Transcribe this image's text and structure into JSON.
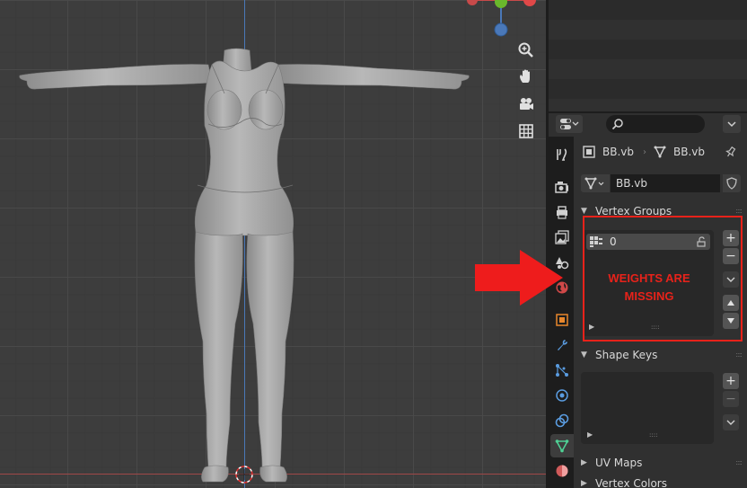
{
  "properties": {
    "breadcrumb": {
      "object_name": "BB.vb",
      "mesh_name": "BB.vb"
    },
    "mesh_datablock": {
      "name": "BB.vb"
    },
    "panels": {
      "vertex_groups": {
        "title": "Vertex Groups",
        "items": [
          {
            "name": "0"
          }
        ]
      },
      "shape_keys": {
        "title": "Shape Keys"
      },
      "uv_maps": {
        "title": "UV Maps"
      },
      "vertex_colors": {
        "title": "Vertex Colors"
      }
    },
    "buttons": {
      "add": "+",
      "remove": "−"
    }
  },
  "annotation": {
    "line1": "WEIGHTS ARE",
    "line2": "MISSING",
    "color": "#e8221a"
  },
  "colors": {
    "accent_active_tab": "#4fcf94",
    "axis_x": "#a04848",
    "axis_y": "#4a78b8"
  }
}
